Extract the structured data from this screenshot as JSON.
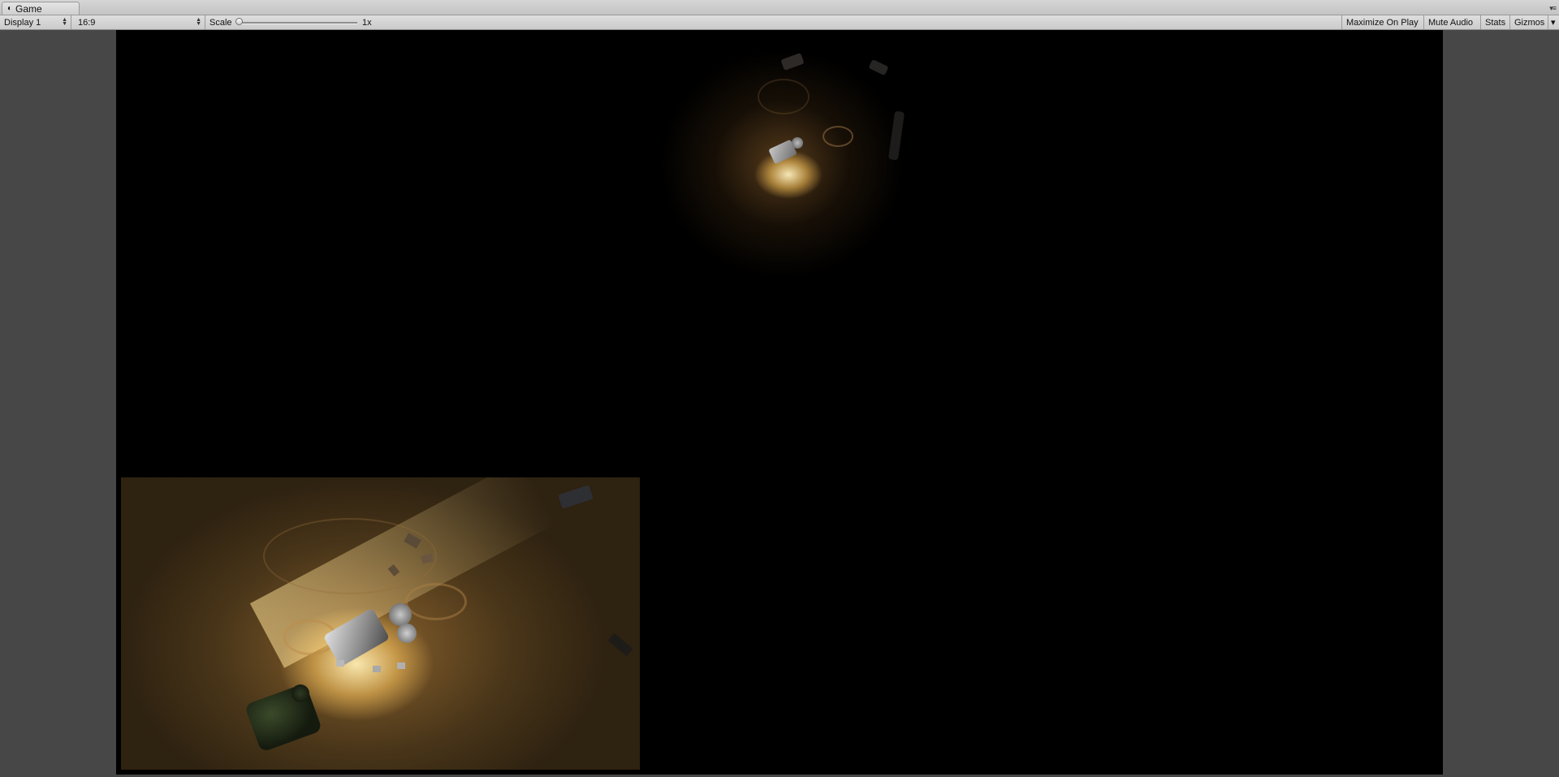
{
  "window": {
    "tab_title": "Game",
    "tab_icon": "game-controller-icon",
    "menu_icon": "window-menu-icon"
  },
  "toolbar": {
    "display_select": "Display 1",
    "aspect_select": "16:9",
    "scale_label": "Scale",
    "scale_value": "1x",
    "scale_level": 0,
    "maximize_on_play": "Maximize On Play",
    "mute_audio": "Mute Audio",
    "stats": "Stats",
    "gizmos": "Gizmos"
  },
  "colors": {
    "toolbar_bg": "#d0d0d0",
    "viewport_bg": "#474747",
    "screen_bg": "#000000",
    "light_glow": "#ffd88a"
  }
}
